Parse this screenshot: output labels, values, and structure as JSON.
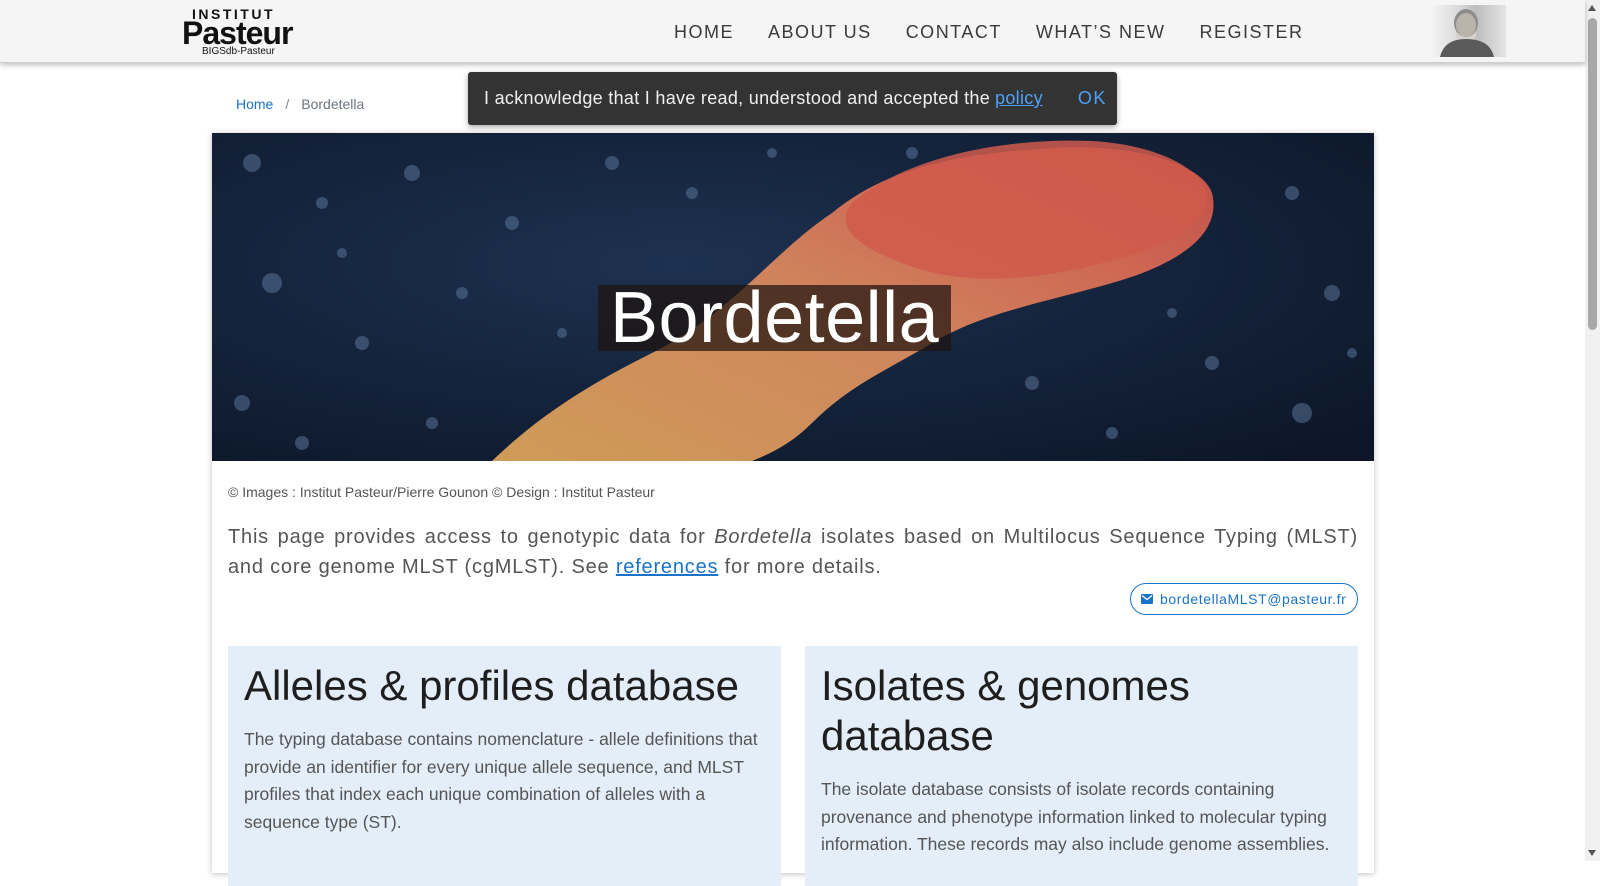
{
  "logo": {
    "line1": "INSTITUT",
    "line2": "Pasteur",
    "line3": "BIGSdb-Pasteur"
  },
  "nav": {
    "items": [
      "HOME",
      "ABOUT US",
      "CONTACT",
      "WHAT’S NEW",
      "REGISTER"
    ]
  },
  "breadcrumb": {
    "home": "Home",
    "separator": "/",
    "current": "Bordetella"
  },
  "cookie_toast": {
    "text": "I acknowledge that I have read, understood and accepted the",
    "link": "policy",
    "button": "OK"
  },
  "hero": {
    "title": "Bordetella"
  },
  "credits": "© Images : Institut Pasteur/Pierre Gounon © Design : Institut Pasteur",
  "intro": {
    "before": "This page provides access to genotypic data for",
    "genus": "Bordetella",
    "middle": "isolates based on Multilocus Sequence Typing (MLST) and core genome MLST (cgMLST). See",
    "link": "references",
    "after": "for more details."
  },
  "contact": {
    "email": "bordetellaMLST@pasteur.fr",
    "icon": "mail-icon"
  },
  "databases": [
    {
      "title": "Alleles & profiles database",
      "description": "The typing database contains nomenclature - allele definitions that provide an identifier for every unique allele sequence, and MLST profiles that index each unique combination of alleles with a sequence type (ST)."
    },
    {
      "title": "Isolates & genomes database",
      "description": "The isolate database consists of isolate records containing provenance and phenotype information linked to molecular typing information. These records may also include genome assemblies."
    }
  ],
  "colors": {
    "link": "#1a73c8",
    "toast_bg": "#333333",
    "db_box_bg": "#e3eef9"
  }
}
